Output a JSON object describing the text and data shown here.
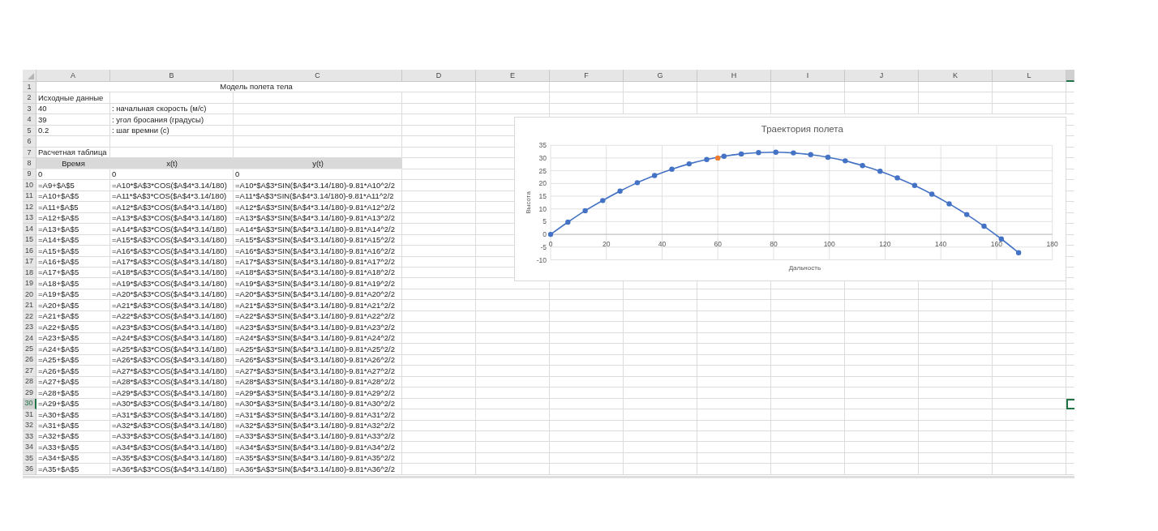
{
  "sheet": {
    "columns": [
      {
        "label": "A",
        "selected": false
      },
      {
        "label": "B",
        "selected": false
      },
      {
        "label": "C",
        "selected": false
      },
      {
        "label": "D",
        "selected": false
      },
      {
        "label": "E",
        "selected": false
      },
      {
        "label": "F",
        "selected": false
      },
      {
        "label": "G",
        "selected": false
      },
      {
        "label": "H",
        "selected": false
      },
      {
        "label": "I",
        "selected": false
      },
      {
        "label": "J",
        "selected": false
      },
      {
        "label": "K",
        "selected": false
      },
      {
        "label": "L",
        "selected": false
      },
      {
        "selected": true
      }
    ],
    "rows": [
      {
        "number": "1",
        "selected": false,
        "kind": "title",
        "cells": [
          "Модель полета тела"
        ]
      },
      {
        "number": "2",
        "selected": false,
        "kind": "data",
        "cells": [
          "Исходные данные"
        ]
      },
      {
        "number": "3",
        "selected": false,
        "kind": "data",
        "cells": [
          "40",
          ": начальная скорость (м/с)"
        ]
      },
      {
        "number": "4",
        "selected": false,
        "kind": "data",
        "cells": [
          "39",
          ": угол бросания (градусы)"
        ]
      },
      {
        "number": "5",
        "selected": false,
        "kind": "data",
        "cells": [
          "0.2",
          ": шаг времни (с)"
        ]
      },
      {
        "number": "6",
        "selected": false,
        "kind": "data"
      },
      {
        "number": "7",
        "selected": false,
        "kind": "data",
        "cells": [
          "Расчетная таблица"
        ]
      },
      {
        "number": "8",
        "selected": false,
        "kind": "header",
        "cells": [
          "Время",
          "x(t)",
          "y(t)"
        ]
      },
      {
        "number": "9",
        "selected": false,
        "kind": "data",
        "cells": [
          "0",
          "0",
          "0"
        ]
      },
      {
        "number": "10",
        "selected": false,
        "kind": "data",
        "cells": [
          "=A9+$A$5",
          "=A10*$A$3*COS($A$4*3.14/180)",
          "=A10*$A$3*SIN($A$4*3.14/180)-9.81*A10^2/2"
        ]
      },
      {
        "number": "11",
        "selected": false,
        "kind": "data",
        "cells": [
          "=A10+$A$5",
          "=A11*$A$3*COS($A$4*3.14/180)",
          "=A11*$A$3*SIN($A$4*3.14/180)-9.81*A11^2/2"
        ]
      },
      {
        "number": "12",
        "selected": false,
        "kind": "data",
        "cells": [
          "=A11+$A$5",
          "=A12*$A$3*COS($A$4*3.14/180)",
          "=A12*$A$3*SIN($A$4*3.14/180)-9.81*A12^2/2"
        ]
      },
      {
        "number": "13",
        "selected": false,
        "kind": "data",
        "cells": [
          "=A12+$A$5",
          "=A13*$A$3*COS($A$4*3.14/180)",
          "=A13*$A$3*SIN($A$4*3.14/180)-9.81*A13^2/2"
        ]
      },
      {
        "number": "14",
        "selected": false,
        "kind": "data",
        "cells": [
          "=A13+$A$5",
          "=A14*$A$3*COS($A$4*3.14/180)",
          "=A14*$A$3*SIN($A$4*3.14/180)-9.81*A14^2/2"
        ]
      },
      {
        "number": "15",
        "selected": false,
        "kind": "data",
        "cells": [
          "=A14+$A$5",
          "=A15*$A$3*COS($A$4*3.14/180)",
          "=A15*$A$3*SIN($A$4*3.14/180)-9.81*A15^2/2"
        ]
      },
      {
        "number": "16",
        "selected": false,
        "kind": "data",
        "cells": [
          "=A15+$A$5",
          "=A16*$A$3*COS($A$4*3.14/180)",
          "=A16*$A$3*SIN($A$4*3.14/180)-9.81*A16^2/2"
        ]
      },
      {
        "number": "17",
        "selected": false,
        "kind": "data",
        "cells": [
          "=A16+$A$5",
          "=A17*$A$3*COS($A$4*3.14/180)",
          "=A17*$A$3*SIN($A$4*3.14/180)-9.81*A17^2/2"
        ]
      },
      {
        "number": "18",
        "selected": false,
        "kind": "data",
        "cells": [
          "=A17+$A$5",
          "=A18*$A$3*COS($A$4*3.14/180)",
          "=A18*$A$3*SIN($A$4*3.14/180)-9.81*A18^2/2"
        ]
      },
      {
        "number": "19",
        "selected": false,
        "kind": "data",
        "cells": [
          "=A18+$A$5",
          "=A19*$A$3*COS($A$4*3.14/180)",
          "=A19*$A$3*SIN($A$4*3.14/180)-9.81*A19^2/2"
        ]
      },
      {
        "number": "20",
        "selected": false,
        "kind": "data",
        "cells": [
          "=A19+$A$5",
          "=A20*$A$3*COS($A$4*3.14/180)",
          "=A20*$A$3*SIN($A$4*3.14/180)-9.81*A20^2/2"
        ]
      },
      {
        "number": "21",
        "selected": false,
        "kind": "data",
        "cells": [
          "=A20+$A$5",
          "=A21*$A$3*COS($A$4*3.14/180)",
          "=A21*$A$3*SIN($A$4*3.14/180)-9.81*A21^2/2"
        ]
      },
      {
        "number": "22",
        "selected": false,
        "kind": "data",
        "cells": [
          "=A21+$A$5",
          "=A22*$A$3*COS($A$4*3.14/180)",
          "=A22*$A$3*SIN($A$4*3.14/180)-9.81*A22^2/2"
        ]
      },
      {
        "number": "23",
        "selected": false,
        "kind": "data",
        "cells": [
          "=A22+$A$5",
          "=A23*$A$3*COS($A$4*3.14/180)",
          "=A23*$A$3*SIN($A$4*3.14/180)-9.81*A23^2/2"
        ]
      },
      {
        "number": "24",
        "selected": false,
        "kind": "data",
        "cells": [
          "=A23+$A$5",
          "=A24*$A$3*COS($A$4*3.14/180)",
          "=A24*$A$3*SIN($A$4*3.14/180)-9.81*A24^2/2"
        ]
      },
      {
        "number": "25",
        "selected": false,
        "kind": "data",
        "cells": [
          "=A24+$A$5",
          "=A25*$A$3*COS($A$4*3.14/180)",
          "=A25*$A$3*SIN($A$4*3.14/180)-9.81*A25^2/2"
        ]
      },
      {
        "number": "26",
        "selected": false,
        "kind": "data",
        "cells": [
          "=A25+$A$5",
          "=A26*$A$3*COS($A$4*3.14/180)",
          "=A26*$A$3*SIN($A$4*3.14/180)-9.81*A26^2/2"
        ]
      },
      {
        "number": "27",
        "selected": false,
        "kind": "data",
        "cells": [
          "=A26+$A$5",
          "=A27*$A$3*COS($A$4*3.14/180)",
          "=A27*$A$3*SIN($A$4*3.14/180)-9.81*A27^2/2"
        ]
      },
      {
        "number": "28",
        "selected": false,
        "kind": "data",
        "cells": [
          "=A27+$A$5",
          "=A28*$A$3*COS($A$4*3.14/180)",
          "=A28*$A$3*SIN($A$4*3.14/180)-9.81*A28^2/2"
        ]
      },
      {
        "number": "29",
        "selected": false,
        "kind": "data",
        "cells": [
          "=A28+$A$5",
          "=A29*$A$3*COS($A$4*3.14/180)",
          "=A29*$A$3*SIN($A$4*3.14/180)-9.81*A29^2/2"
        ]
      },
      {
        "number": "30",
        "selected": true,
        "kind": "data",
        "cells": [
          "=A29+$A$5",
          "=A30*$A$3*COS($A$4*3.14/180)",
          "=A30*$A$3*SIN($A$4*3.14/180)-9.81*A30^2/2"
        ]
      },
      {
        "number": "31",
        "selected": false,
        "kind": "data",
        "cells": [
          "=A30+$A$5",
          "=A31*$A$3*COS($A$4*3.14/180)",
          "=A31*$A$3*SIN($A$4*3.14/180)-9.81*A31^2/2"
        ]
      },
      {
        "number": "32",
        "selected": false,
        "kind": "data",
        "cells": [
          "=A31+$A$5",
          "=A32*$A$3*COS($A$4*3.14/180)",
          "=A32*$A$3*SIN($A$4*3.14/180)-9.81*A32^2/2"
        ]
      },
      {
        "number": "33",
        "selected": false,
        "kind": "data",
        "cells": [
          "=A32+$A$5",
          "=A33*$A$3*COS($A$4*3.14/180)",
          "=A33*$A$3*SIN($A$4*3.14/180)-9.81*A33^2/2"
        ]
      },
      {
        "number": "34",
        "selected": false,
        "kind": "data",
        "cells": [
          "=A33+$A$5",
          "=A34*$A$3*COS($A$4*3.14/180)",
          "=A34*$A$3*SIN($A$4*3.14/180)-9.81*A34^2/2"
        ]
      },
      {
        "number": "35",
        "selected": false,
        "kind": "data",
        "cells": [
          "=A34+$A$5",
          "=A35*$A$3*COS($A$4*3.14/180)",
          "=A35*$A$3*SIN($A$4*3.14/180)-9.81*A35^2/2"
        ]
      },
      {
        "number": "36",
        "selected": false,
        "kind": "data",
        "cells": [
          "=A35+$A$5",
          "=A36*$A$3*COS($A$4*3.14/180)",
          "=A36*$A$3*SIN($A$4*3.14/180)-9.81*A36^2/2"
        ]
      }
    ]
  },
  "chart": {
    "chart_data": {
      "type": "line",
      "title": "Траектория полета",
      "xlabel": "Дальность",
      "ylabel": "Высота",
      "grid": true,
      "x": [
        0,
        6.2,
        12.4,
        18.7,
        24.9,
        31.1,
        37.3,
        43.5,
        49.7,
        56.0,
        60,
        62.2,
        68.4,
        74.6,
        80.8,
        87.1,
        93.3,
        99.5,
        105.7,
        111.9,
        118.2,
        124.4,
        130.6,
        136.8,
        143.0,
        149.3,
        155.5,
        161.7,
        167.9
      ],
      "series": [
        {
          "color": "#4472c4",
          "marker": "circle",
          "values": [
            0,
            4.8,
            9.3,
            13.3,
            17.0,
            20.3,
            23.1,
            25.6,
            27.7,
            29.4,
            null,
            30.7,
            31.6,
            32.1,
            32.3,
            32.0,
            31.3,
            30.3,
            28.9,
            27.0,
            24.8,
            22.2,
            19.2,
            15.8,
            12.0,
            7.8,
            3.2,
            -1.8,
            -7.2
          ]
        },
        {
          "color": "#ed7d31",
          "marker": "circle",
          "values": [
            null,
            null,
            null,
            null,
            null,
            null,
            null,
            null,
            null,
            null,
            30,
            null,
            null,
            null,
            null,
            null,
            null,
            null,
            null,
            null,
            null,
            null,
            null,
            null,
            null,
            null,
            null,
            null,
            null
          ]
        }
      ],
      "xlim": [
        0,
        180
      ],
      "ylim": [
        -10,
        35
      ],
      "xticks": [
        0,
        20,
        40,
        60,
        80,
        100,
        120,
        140,
        160,
        180
      ],
      "yticks": [
        -10,
        -5,
        0,
        5,
        10,
        15,
        20,
        25,
        30,
        35
      ]
    }
  }
}
